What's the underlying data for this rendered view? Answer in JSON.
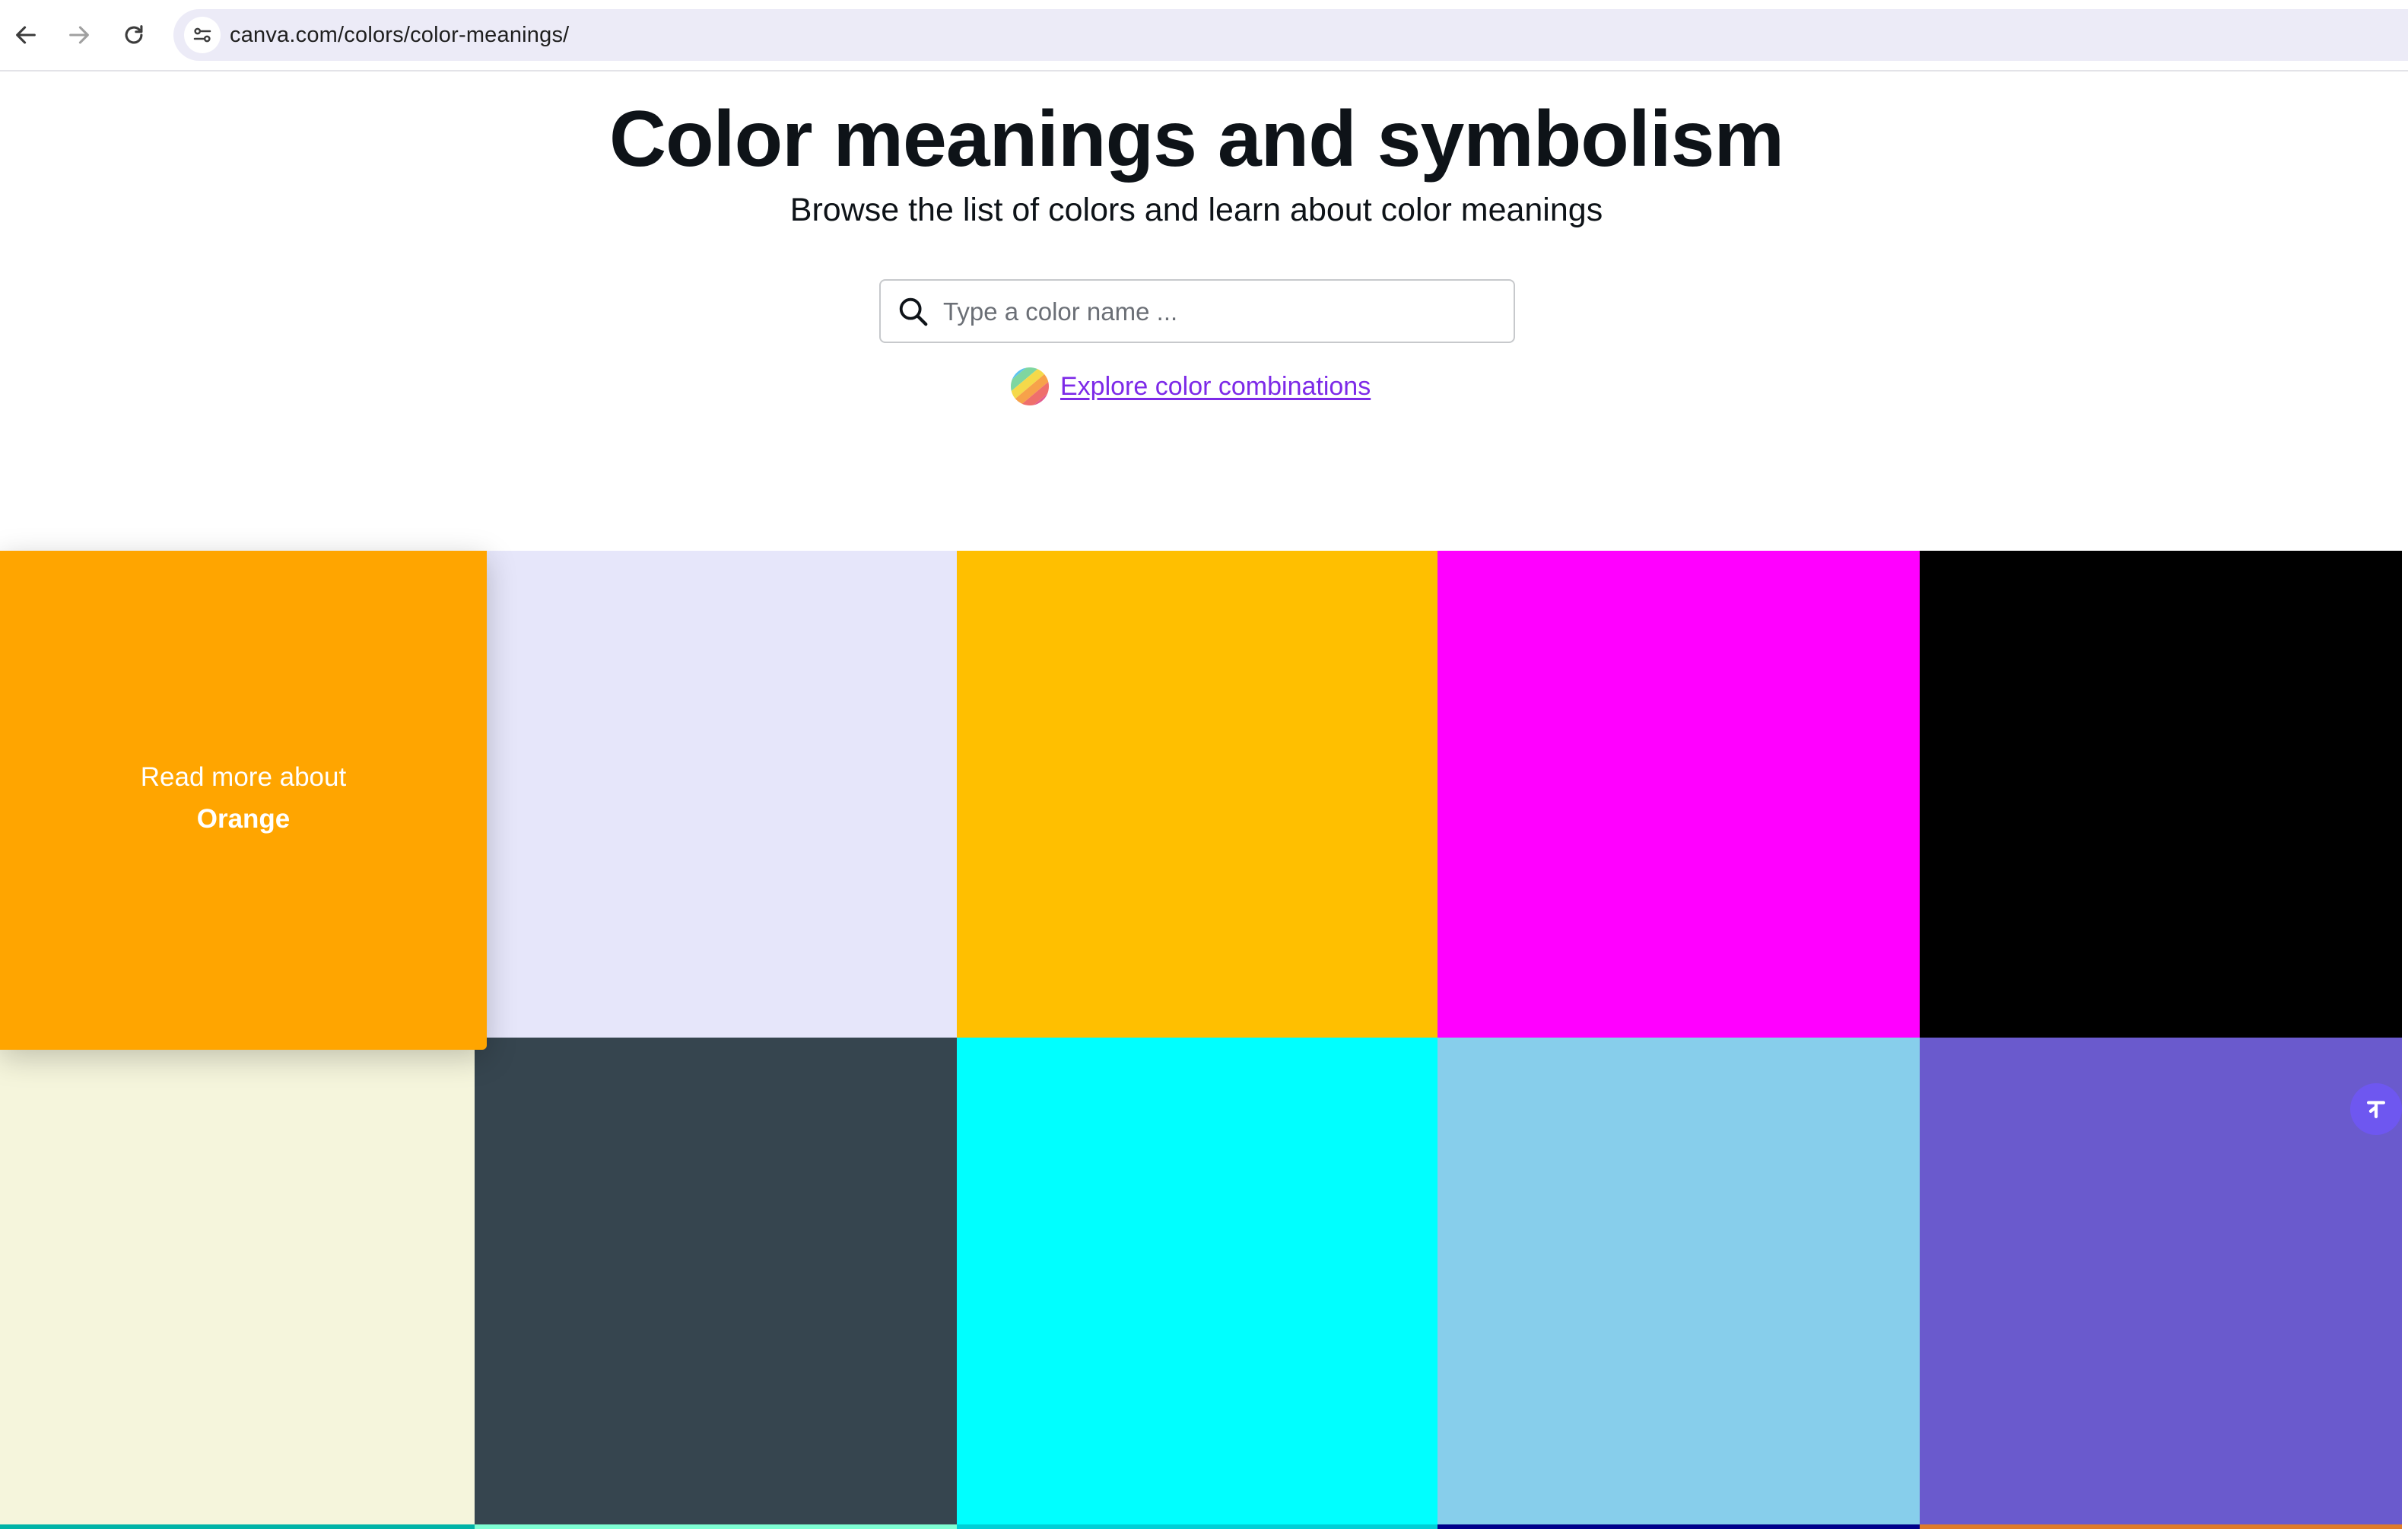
{
  "browser": {
    "url": "canva.com/colors/color-meanings/"
  },
  "hero": {
    "title": "Color meanings and symbolism",
    "subtitle": "Browse the list of colors and learn about color meanings",
    "search_placeholder": "Type a color name ...",
    "explore_link": "Explore color combinations"
  },
  "grid": {
    "tiles": [
      {
        "color": "#FFA500",
        "name": "Orange",
        "hovered": true,
        "hover_prefix": "Read more about"
      },
      {
        "color": "#E6E6FA"
      },
      {
        "color": "#FFBF00"
      },
      {
        "color": "#FF00FF"
      },
      {
        "color": "#000000"
      },
      {
        "color": "#F5F5DC"
      },
      {
        "color": "#36454F"
      },
      {
        "color": "#00FFFF"
      },
      {
        "color": "#87CEEB"
      },
      {
        "color": "#6A5ACD"
      }
    ]
  },
  "colors": {
    "link": "#7D2AE8",
    "float_button": "#6E57F0"
  }
}
